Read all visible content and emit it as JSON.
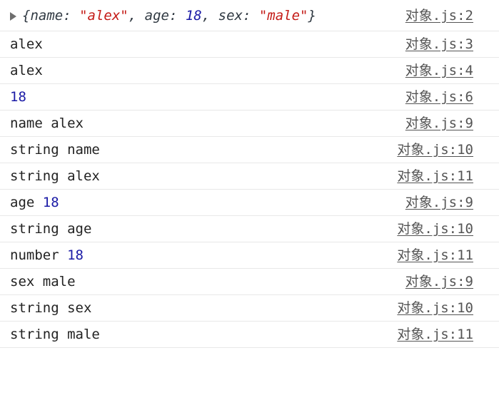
{
  "rows": [
    {
      "object": {
        "open": "{",
        "k1": "name",
        "sep1": ": ",
        "v1": "\"alex\"",
        "c1": ", ",
        "k2": "age",
        "sep2": ": ",
        "v2": "18",
        "c2": ", ",
        "k3": "sex",
        "sep3": ": ",
        "v3": "\"male\"",
        "close": "}"
      },
      "source": "对象.js:2"
    },
    {
      "text": "alex",
      "source": "对象.js:3"
    },
    {
      "text": "alex",
      "source": "对象.js:4"
    },
    {
      "number": "18",
      "source": "对象.js:6"
    },
    {
      "text": "name alex",
      "source": "对象.js:9"
    },
    {
      "text": "string name",
      "source": "对象.js:10"
    },
    {
      "text": "string alex",
      "source": "对象.js:11"
    },
    {
      "prefix": "age ",
      "number": "18",
      "source": "对象.js:9"
    },
    {
      "text": "string age",
      "source": "对象.js:10"
    },
    {
      "prefix": "number ",
      "number": "18",
      "source": "对象.js:11"
    },
    {
      "text": "sex male",
      "source": "对象.js:9"
    },
    {
      "text": "string sex",
      "source": "对象.js:10"
    },
    {
      "text": "string male",
      "source": "对象.js:11"
    }
  ],
  "colors": {
    "string": "#c41a16",
    "number": "#1a1aa6",
    "link": "#545454",
    "divider": "#e8e8e8"
  },
  "icons": {
    "expand": "triangle-right-icon"
  }
}
